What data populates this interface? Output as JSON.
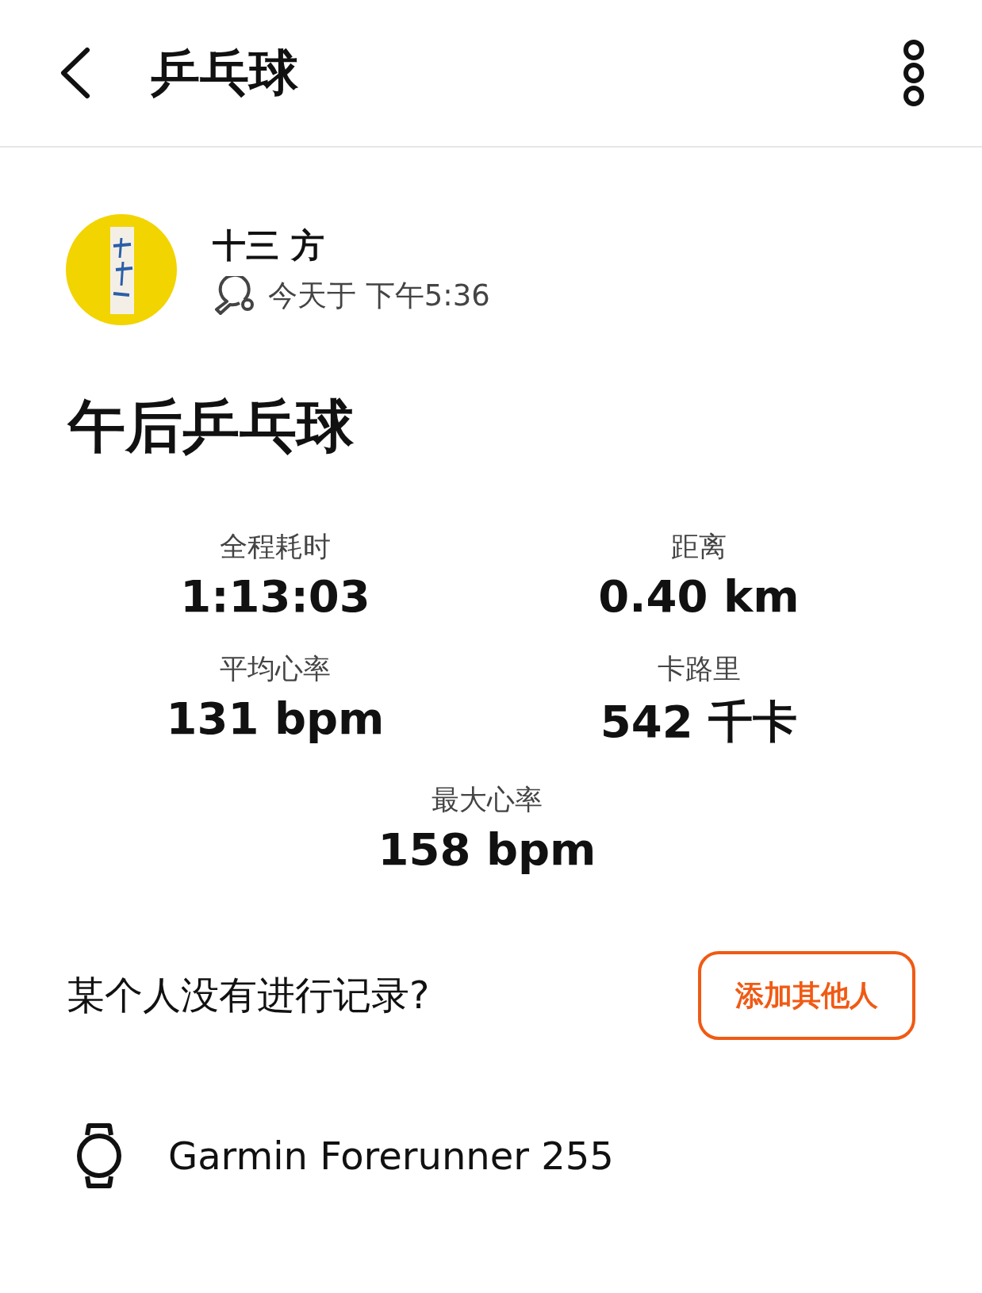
{
  "header": {
    "title": "乒乓球"
  },
  "athlete": {
    "name": "十三 方",
    "time": "今天于 下午5:36"
  },
  "activity_title": "午后乒乓球",
  "stats": [
    {
      "label": "全程耗时",
      "value": "1:13:03"
    },
    {
      "label": "距离",
      "value": "0.40 km"
    },
    {
      "label": "平均心率",
      "value": "131 bpm"
    },
    {
      "label": "卡路里",
      "value": "542 千卡"
    },
    {
      "label": "最大心率",
      "value": "158 bpm"
    }
  ],
  "prompt": {
    "text": "某个人没有进行记录?",
    "button": "添加其他人"
  },
  "device": {
    "name": "Garmin Forerunner 255"
  }
}
